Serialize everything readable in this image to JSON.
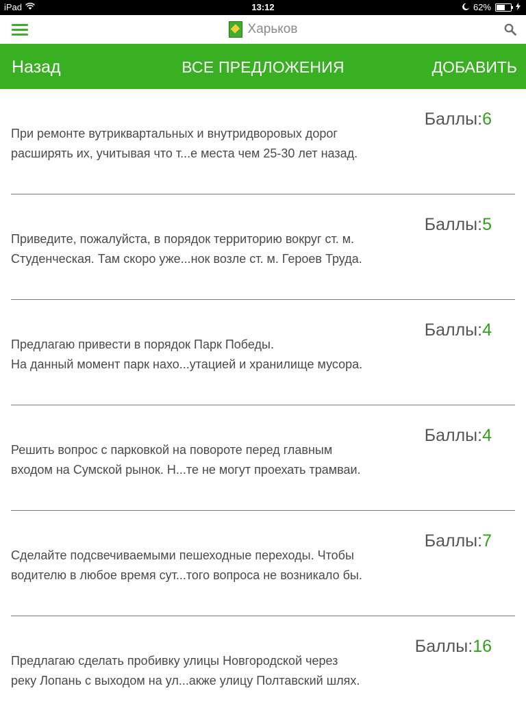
{
  "status_bar": {
    "device": "iPad",
    "time": "13:12",
    "battery": "62%",
    "battery_level": 0.62
  },
  "app_bar": {
    "city": "Харьков"
  },
  "nav": {
    "back_label": "Назад",
    "title": "ВСЕ ПРЕДЛОЖЕНИЯ",
    "add_label": "ДОБАВИТЬ"
  },
  "score_label": "Баллы:",
  "proposals": [
    {
      "line1": "При ремонте вутриквартальных и внутридворовых дорог",
      "line2": "расширять их, учитывая что т...е места чем 25-30 лет назад.",
      "score": "6"
    },
    {
      "line1": "Приведите, пожалуйста, в порядок территорию вокруг ст. м.",
      "line2": "Студенческая. Там скоро уже...нок возле ст. м. Героев Труда.",
      "score": "5"
    },
    {
      "line1": "Предлагаю привести в порядок Парк Победы.",
      "line2": "На данный момент парк нахо...утацией и хранилище мусора.",
      "score": "4"
    },
    {
      "line1": "Решить вопрос с парковкой на повороте перед главным",
      "line2": "входом на Сумской рынок. Н...те не могут проехать трамваи.",
      "score": "4"
    },
    {
      "line1": "Сделайте подсвечиваемыми пешеходные переходы. Чтобы",
      "line2": "водителю в любое время сут...того вопроса не возникало бы.",
      "score": "7"
    },
    {
      "line1": "Предлагаю сделать пробивку улицы Новгородской через",
      "line2": "реку Лопань с выходом на ул...акже улицу Полтавский шлях.",
      "score": "16"
    }
  ],
  "colors": {
    "accent_green": "#38b021",
    "score_green": "#2ea31a"
  }
}
